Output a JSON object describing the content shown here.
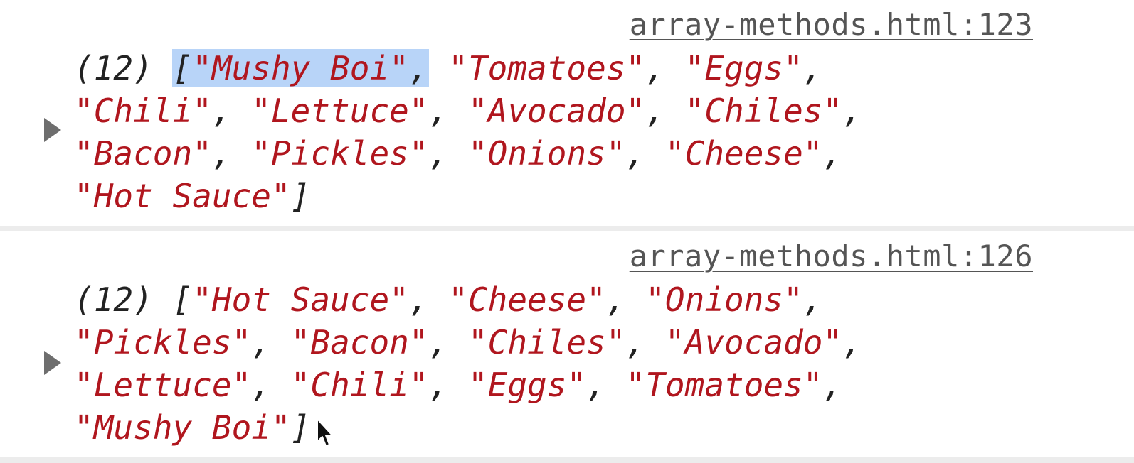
{
  "entries": [
    {
      "source": "array-methods.html:123",
      "length_label": "(12)",
      "items": [
        "Mushy Boi",
        "Tomatoes",
        "Eggs",
        "Chili",
        "Lettuce",
        "Avocado",
        "Chiles",
        "Bacon",
        "Pickles",
        "Onions",
        "Cheese",
        "Hot Sauce"
      ]
    },
    {
      "source": "array-methods.html:126",
      "length_label": "(12)",
      "items": [
        "Hot Sauce",
        "Cheese",
        "Onions",
        "Pickles",
        "Bacon",
        "Chiles",
        "Avocado",
        "Lettuce",
        "Chili",
        "Eggs",
        "Tomatoes",
        "Mushy Boi"
      ]
    }
  ],
  "colors": {
    "string": "#b0161e",
    "selection": "#b8d4f8",
    "link": "#555555"
  },
  "icons": {
    "expand": "triangle-right-icon",
    "pointer": "mouse-cursor-icon"
  }
}
